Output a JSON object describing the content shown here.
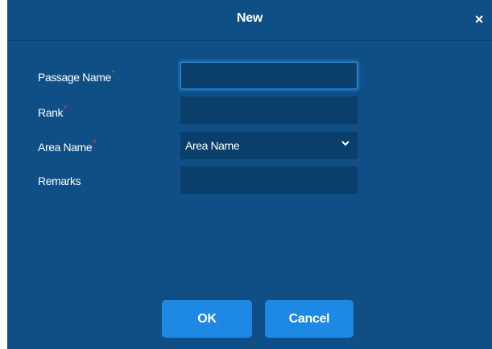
{
  "dialog": {
    "title": "New",
    "close_symbol": "×"
  },
  "form": {
    "passage_name_label": "Passage Name",
    "passage_name_value": "",
    "rank_label": "Rank",
    "rank_value": "",
    "area_name_label": "Area Name",
    "area_name_selected": "Area Name",
    "remarks_label": "Remarks",
    "remarks_value": "",
    "required_marker": "*"
  },
  "buttons": {
    "ok_label": "OK",
    "cancel_label": "Cancel"
  },
  "colors": {
    "dialog_bg": "#0f4f86",
    "field_bg": "#0b3f6b",
    "button_bg": "#1e88e5",
    "required": "#ff3b3b",
    "focus_border": "#2e8fe0"
  },
  "icons": {
    "close": "close-icon",
    "dropdown": "chevron-down-icon"
  }
}
